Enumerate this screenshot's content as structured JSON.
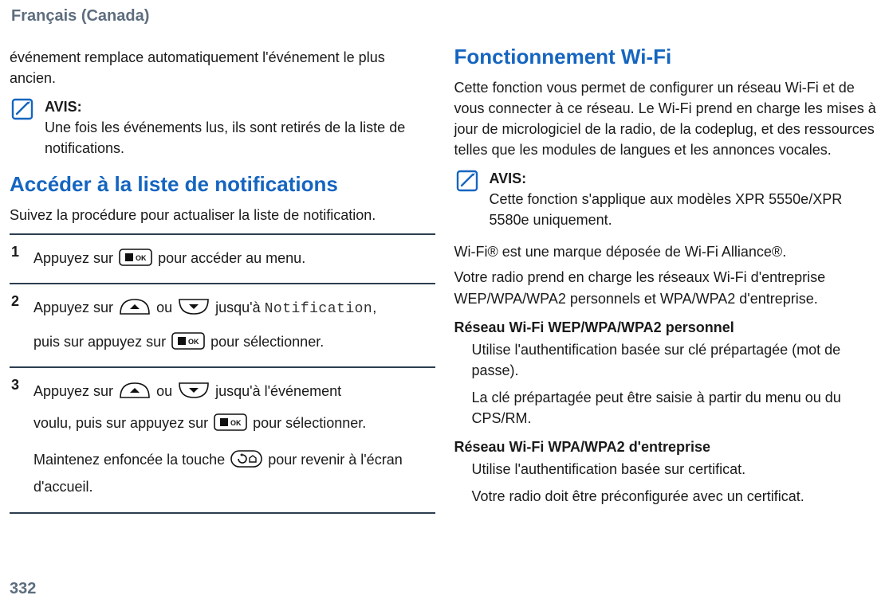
{
  "header": {
    "language": "Français (Canada)"
  },
  "pageNumber": "332",
  "left": {
    "leadIn": "événement remplace automatiquement l'événement le plus ancien.",
    "notice": {
      "label": "AVIS:",
      "text": "Une fois les événements lus, ils sont retirés de la liste de notifications."
    },
    "sectionTitle": "Accéder à la liste de notifications",
    "intro": "Suivez la procédure pour actualiser la liste de notification.",
    "steps": {
      "s1": {
        "num": "1",
        "t1a": "Appuyez sur ",
        "t1b": " pour accéder au menu."
      },
      "s2": {
        "num": "2",
        "t1a": "Appuyez sur ",
        "t1b": " ou ",
        "t1c": " jusqu'à ",
        "mono": "Notification",
        "t1d": ",",
        "t2a": "puis sur appuyez sur ",
        "t2b": " pour sélectionner."
      },
      "s3": {
        "num": "3",
        "t1a": "Appuyez sur ",
        "t1b": " ou ",
        "t1c": " jusqu'à l'événement",
        "t2a": "voulu, puis sur appuyez sur ",
        "t2b": " pour sélectionner.",
        "t3a": "Maintenez enfoncée la touche ",
        "t3b": " pour revenir à l'écran d'accueil."
      }
    }
  },
  "right": {
    "sectionTitle": "Fonctionnement Wi-Fi",
    "intro": "Cette fonction vous permet de configurer un réseau Wi-Fi et de vous connecter à ce réseau. Le Wi-Fi prend en charge les mises à jour de micrologiciel de la radio, de la codeplug, et des ressources telles que les modules de langues et les annonces vocales.",
    "notice": {
      "label": "AVIS:",
      "text": "Cette fonction s'applique aux modèles XPR 5550e/XPR 5580e uniquement."
    },
    "trademark": "Wi-Fi® est une marque déposée de Wi-Fi Alliance®.",
    "networksIntro": "Votre radio prend en charge les réseaux Wi-Fi d'entreprise WEP/WPA/WPA2 personnels et WPA/WPA2 d'entreprise.",
    "def1Term": "Réseau Wi-Fi WEP/WPA/WPA2 personnel",
    "def1Body1": "Utilise l'authentification basée sur clé prépartagée (mot de passe).",
    "def1Body2": "La clé prépartagée peut être saisie à partir du menu ou du CPS/RM.",
    "def2Term": "Réseau Wi-Fi WPA/WPA2 d'entreprise",
    "def2Body1": "Utilise l'authentification basée sur certificat.",
    "def2Body2": "Votre radio doit être préconfigurée avec un certificat."
  }
}
